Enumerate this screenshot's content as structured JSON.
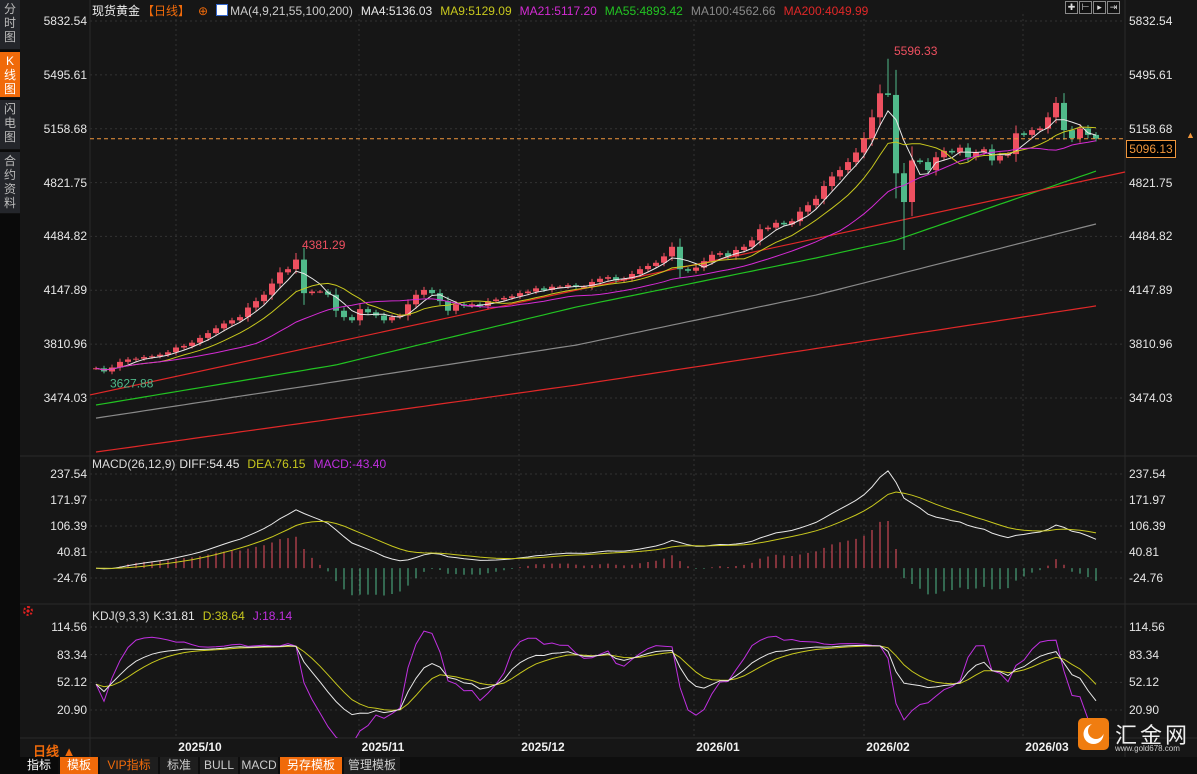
{
  "sidebar": {
    "tabs": [
      {
        "label": "分时图",
        "active": false
      },
      {
        "label": "K线图",
        "active": true
      },
      {
        "label": "闪电图",
        "active": false
      },
      {
        "label": "合约资料",
        "active": false
      }
    ]
  },
  "header": {
    "symbol": "现货黄金",
    "period": "【日线】",
    "ma_params": "MA(4,9,21,55,100,200)",
    "ma_values": [
      {
        "label": "MA4:5136.03",
        "color": "#e8e8e8"
      },
      {
        "label": "MA9:5129.09",
        "color": "#c8c81e"
      },
      {
        "label": "MA21:5117.20",
        "color": "#d42bd4"
      },
      {
        "label": "MA55:4893.42",
        "color": "#22c322"
      },
      {
        "label": "MA100:4562.66",
        "color": "#8a8a8a"
      },
      {
        "label": "MA200:4049.99",
        "color": "#e02828"
      }
    ]
  },
  "toolbar_icons": [
    "crosshair-icon",
    "zoom-range-icon",
    "play-forward-icon",
    "move-right-icon"
  ],
  "last_price": "5096.13",
  "colors": {
    "up": "#ee5060",
    "down": "#50b98a",
    "accent": "#f06a0a",
    "last_price_line": "#f0963c"
  },
  "chart_data": [
    {
      "type": "candlestick",
      "title": "现货黄金 日线",
      "y_ticks": [
        "5832.54",
        "5495.61",
        "5158.68",
        "4821.75",
        "4484.82",
        "4147.89",
        "3810.96",
        "3474.03"
      ],
      "ylim": [
        3474.03,
        5832.54
      ],
      "grid": true,
      "closes": [
        3660,
        3640,
        3665,
        3700,
        3715,
        3720,
        3730,
        3735,
        3745,
        3760,
        3790,
        3800,
        3820,
        3850,
        3880,
        3910,
        3940,
        3960,
        3980,
        4040,
        4080,
        4120,
        4190,
        4260,
        4280,
        4340,
        4130,
        4140,
        4140,
        4120,
        4020,
        3980,
        3960,
        4030,
        4010,
        3990,
        3960,
        3980,
        3990,
        4060,
        4120,
        4150,
        4130,
        4080,
        4020,
        4060,
        4050,
        4060,
        4050,
        4080,
        4090,
        4100,
        4110,
        4130,
        4140,
        4160,
        4150,
        4170,
        4170,
        4180,
        4170,
        4170,
        4200,
        4220,
        4230,
        4210,
        4220,
        4250,
        4280,
        4300,
        4320,
        4360,
        4420,
        4280,
        4270,
        4290,
        4330,
        4370,
        4380,
        4360,
        4400,
        4420,
        4460,
        4530,
        4540,
        4570,
        4560,
        4580,
        4640,
        4680,
        4720,
        4800,
        4860,
        4900,
        4950,
        5010,
        5100,
        5230,
        5380,
        5370,
        4880,
        4700,
        4960,
        4950,
        4900,
        4980,
        5020,
        5010,
        5040,
        4980,
        5010,
        5030,
        4960,
        4990,
        5000,
        5130,
        5120,
        5150,
        5160,
        5230,
        5320,
        5150,
        5100,
        5160,
        5120,
        5096.13
      ],
      "marked_points": [
        {
          "label": "5596.33",
          "value": 5596.33,
          "bar": 99,
          "kind": "high",
          "color": "#ee5060"
        },
        {
          "label": "4381.29",
          "value": 4381.29,
          "bar": 25,
          "kind": "high",
          "color": "#ee5060"
        },
        {
          "label": "3627.88",
          "value": 3627.88,
          "bar": 1,
          "kind": "low",
          "color": "#50b98a"
        }
      ],
      "extra_lows": [
        {
          "bar": 101,
          "value": 4400
        }
      ],
      "ma_series": [
        {
          "name": "MA4",
          "period": 4,
          "color": "#e8e8e8"
        },
        {
          "name": "MA9",
          "period": 9,
          "color": "#c8c81e"
        },
        {
          "name": "MA21",
          "period": 21,
          "color": "#d42bd4"
        }
      ],
      "long_ma_series": [
        {
          "name": "MA55",
          "color": "#22c322",
          "points": [
            [
              0,
              3430
            ],
            [
              30,
              3681
            ],
            [
              60,
              4043
            ],
            [
              90,
              4350
            ],
            [
              100,
              4462
            ],
            [
              125,
              4893.42
            ]
          ]
        },
        {
          "name": "MA100",
          "color": "#8a8a8a",
          "points": [
            [
              0,
              3348
            ],
            [
              60,
              3805
            ],
            [
              90,
              4118
            ],
            [
              125,
              4562.66
            ]
          ]
        },
        {
          "name": "MA200",
          "color": "#e02828",
          "points": [
            [
              0,
              3136
            ],
            [
              60,
              3555
            ],
            [
              125,
              4049.99
            ]
          ]
        }
      ],
      "trendline": {
        "color": "#e02828",
        "from": 3493,
        "to": 4888
      },
      "last_price": 5096.13
    },
    {
      "type": "macd",
      "title": "MACD(26,12,9)",
      "legend": [
        {
          "label": "DIFF:54.45",
          "color": "#e8e8e8"
        },
        {
          "label": "DEA:76.15",
          "color": "#c8c81e"
        },
        {
          "label": "MACD:-43.40",
          "color": "#c030e0"
        }
      ],
      "y_ticks": [
        "237.54",
        "171.97",
        "106.39",
        "40.81",
        "-24.76"
      ],
      "ylim": [
        -24.76,
        237.54
      ]
    },
    {
      "type": "kdj",
      "title": "KDJ(9,3,3)",
      "legend": [
        {
          "label": "K:31.81",
          "color": "#e8e8e8"
        },
        {
          "label": "D:38.64",
          "color": "#c8c81e"
        },
        {
          "label": "J:18.14",
          "color": "#c030e0"
        }
      ],
      "y_ticks": [
        "114.56",
        "83.34",
        "52.12",
        "20.90"
      ],
      "ylim": [
        20.9,
        114.56
      ]
    }
  ],
  "x_axis": {
    "labels": [
      "2025/10",
      "2025/11",
      "2025/12",
      "2026/01",
      "2026/02",
      "2026/03"
    ]
  },
  "period_selector": "日线 ▲",
  "bottom_tabs": [
    {
      "label": "指标",
      "style": "white"
    },
    {
      "label": "模板",
      "style": "orange"
    },
    {
      "label": "VIP指标",
      "style": "vip"
    },
    {
      "label": "标准",
      "style": ""
    },
    {
      "label": "BULL",
      "style": ""
    },
    {
      "label": "MACD",
      "style": ""
    },
    {
      "label": "另存模板",
      "style": "orange"
    },
    {
      "label": "管理模板",
      "style": ""
    }
  ],
  "logo": {
    "name": "汇金网",
    "url": "www.gold678.com"
  }
}
